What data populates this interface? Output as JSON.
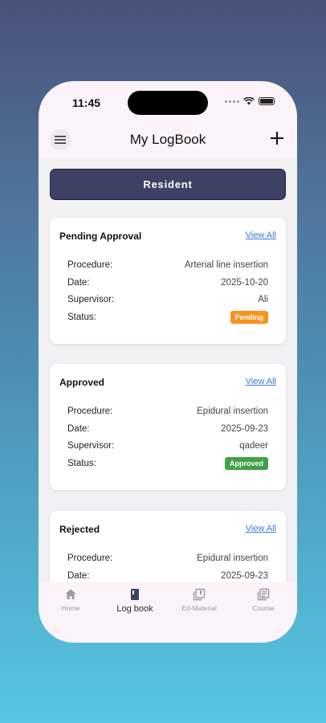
{
  "status_bar": {
    "time": "11:45"
  },
  "app_bar": {
    "title": "My LogBook"
  },
  "role_button": {
    "label": "Resident"
  },
  "cards": [
    {
      "title": "Pending Approval",
      "view_all": "View All",
      "rows": [
        {
          "label": "Procedure:",
          "value": "Arterial line insertion"
        },
        {
          "label": "Date:",
          "value": "2025-10-20"
        },
        {
          "label": "Supervisor:",
          "value": "Ali"
        },
        {
          "label": "Status:",
          "value": "Pending"
        }
      ],
      "status_color": "#f7931e"
    },
    {
      "title": "Approved",
      "view_all": "View All",
      "rows": [
        {
          "label": "Procedure:",
          "value": "Epidural insertion"
        },
        {
          "label": "Date:",
          "value": "2025-09-23"
        },
        {
          "label": "Supervisor:",
          "value": "qadeer"
        },
        {
          "label": "Status:",
          "value": "Approved"
        }
      ],
      "status_color": "#43a047"
    },
    {
      "title": "Rejected",
      "view_all": "View All",
      "rows": [
        {
          "label": "Procedure:",
          "value": "Epidural insertion"
        },
        {
          "label": "Date:",
          "value": "2025-09-23"
        }
      ]
    }
  ],
  "bottom_nav": [
    {
      "label": "Home",
      "icon": "home-icon",
      "active": false
    },
    {
      "label": "Log book",
      "icon": "book-icon",
      "active": true
    },
    {
      "label": "Ed-Material",
      "icon": "library-icon",
      "active": false
    },
    {
      "label": "Course",
      "icon": "course-icon",
      "active": false
    }
  ],
  "colors": {
    "primary": "#3d4264",
    "link": "#3a7bd5"
  }
}
